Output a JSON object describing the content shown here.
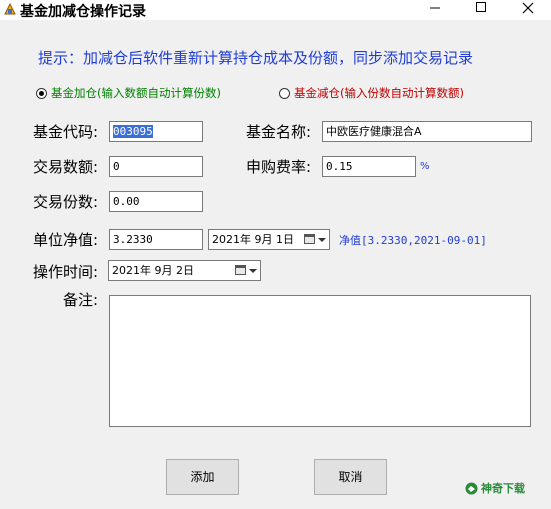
{
  "window": {
    "title": "基金加减仓操作记录"
  },
  "hint": "提示：加减仓后软件重新计算持仓成本及份额，同步添加交易记录",
  "radios": {
    "add_label": "基金加仓(输入数额自动计算份数)",
    "sub_label": "基金减仓(输入份数自动计算数额)"
  },
  "form": {
    "fund_code_label": "基金代码:",
    "fund_code_value": "003095",
    "fund_name_label": "基金名称:",
    "fund_name_value": "中欧医疗健康混合A",
    "trade_amount_label": "交易数额:",
    "trade_amount_value": "0",
    "fee_rate_label": "申购费率:",
    "fee_rate_value": "0.15",
    "fee_unit": "%",
    "trade_shares_label": "交易份数:",
    "trade_shares_value": "0.00",
    "nav_label": "单位净值:",
    "nav_value": "3.2330",
    "nav_date": "2021年  9月  1日",
    "nav_info": "净值[3.2330,2021-09-01]",
    "op_time_label": "操作时间:",
    "op_time_value": "2021年  9月  2日",
    "note_label": "备注:"
  },
  "buttons": {
    "add_label": "添加",
    "cancel_label": "取消"
  },
  "watermark": "神奇下载"
}
